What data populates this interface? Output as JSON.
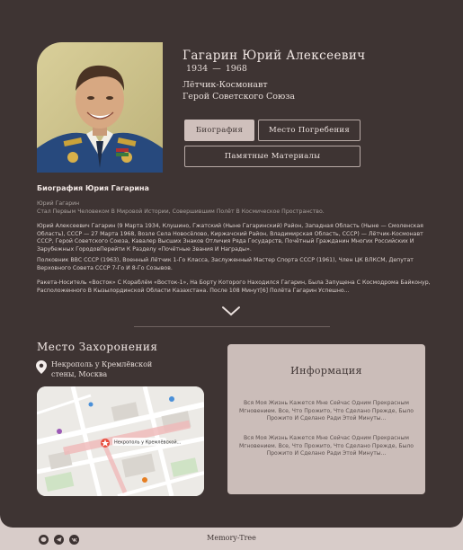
{
  "hero": {
    "name": "Гагарин Юрий Алексеевич",
    "birth_year": "1934",
    "dash": "—",
    "death_year": "1968",
    "title_line1": "Лётчик-Космонавт",
    "title_line2": "Герой Советского Союза",
    "portrait_icon": "portrait-photo"
  },
  "tabs": [
    {
      "label": "Биография",
      "active": true
    },
    {
      "label": "Место Погребения",
      "active": false
    },
    {
      "label": "Памятные Материалы",
      "active": false
    }
  ],
  "bio": {
    "heading": "Биография Юрия Гагарина",
    "subtitle_line1": "Юрий Гагарин",
    "subtitle_line2": "Стал Первым Человеком В Мировой Истории, Совершившим Полёт В Космическое Пространство.",
    "paragraph1": "Юрий Алексеевич Гагарин (9 Марта 1934, Клушино, Гжатский (Ныне Гагаринский) Район, Западная Область (Ныне — Смоленская Область), СССР — 27 Марта 1968, Возле Села Новосёлово, Киржачский Район, Владимирская Область, СССР) — Лётчик-Космонавт СССР, Герой Советского Союза, Кавалер Высших Знаков Отличия Ряда Государств, Почётный Гражданин Многих Российских И Зарубежных ГородовПерейти К Разделу «Почётные Звания И Награды».",
    "paragraph2": "Полковник ВВС СССР (1963), Военный Лётчик 1-Го Класса, Заслуженный Мастер Спорта СССР (1961), Член ЦК ВЛКСМ, Депутат Верховного Совета СССР 7-Го И 8-Го Созывов.",
    "paragraph3": "Ракета-Носитель «Восток» С Кораблём «Восток-1», На Борту Которого Находился Гагарин, Была Запущена С Космодрома Байконур, Расположенного В Кызылординской Области Казахстана. После 108 Минут[6] Полёта Гагарин Успешно...",
    "expand_icon": "chevron-down-icon"
  },
  "burial": {
    "title": "Место Захоронения",
    "place": "Некрополь у Кремлёвской стены, Москва",
    "map_label": "Некрополь у Кремлёвской...",
    "pin_icon": "location-pin-icon"
  },
  "info": {
    "title": "Информация",
    "text1": "Вся Моя Жизнь Кажется Мне Сейчас Одним Прекрасным Мгновением. Все, Что Прожито, Что Сделано Прежде, Было Прожито И Сделано Ради Этой Минуты...",
    "text2": "Вся Моя Жизнь Кажется Мне Сейчас Одним Прекрасным Мгновением. Все, Что Прожито, Что Сделано Прежде, Было Прожито И Сделано Ради Этой Минуты..."
  },
  "footer": {
    "brand": "Memory-Tree",
    "icons": [
      "messenger-icon",
      "telegram-icon",
      "vk-icon"
    ]
  },
  "colors": {
    "background": "#3e3433",
    "frame": "#d8ccc9",
    "accent": "#cfc0bc",
    "pin": "#e74c3c"
  }
}
